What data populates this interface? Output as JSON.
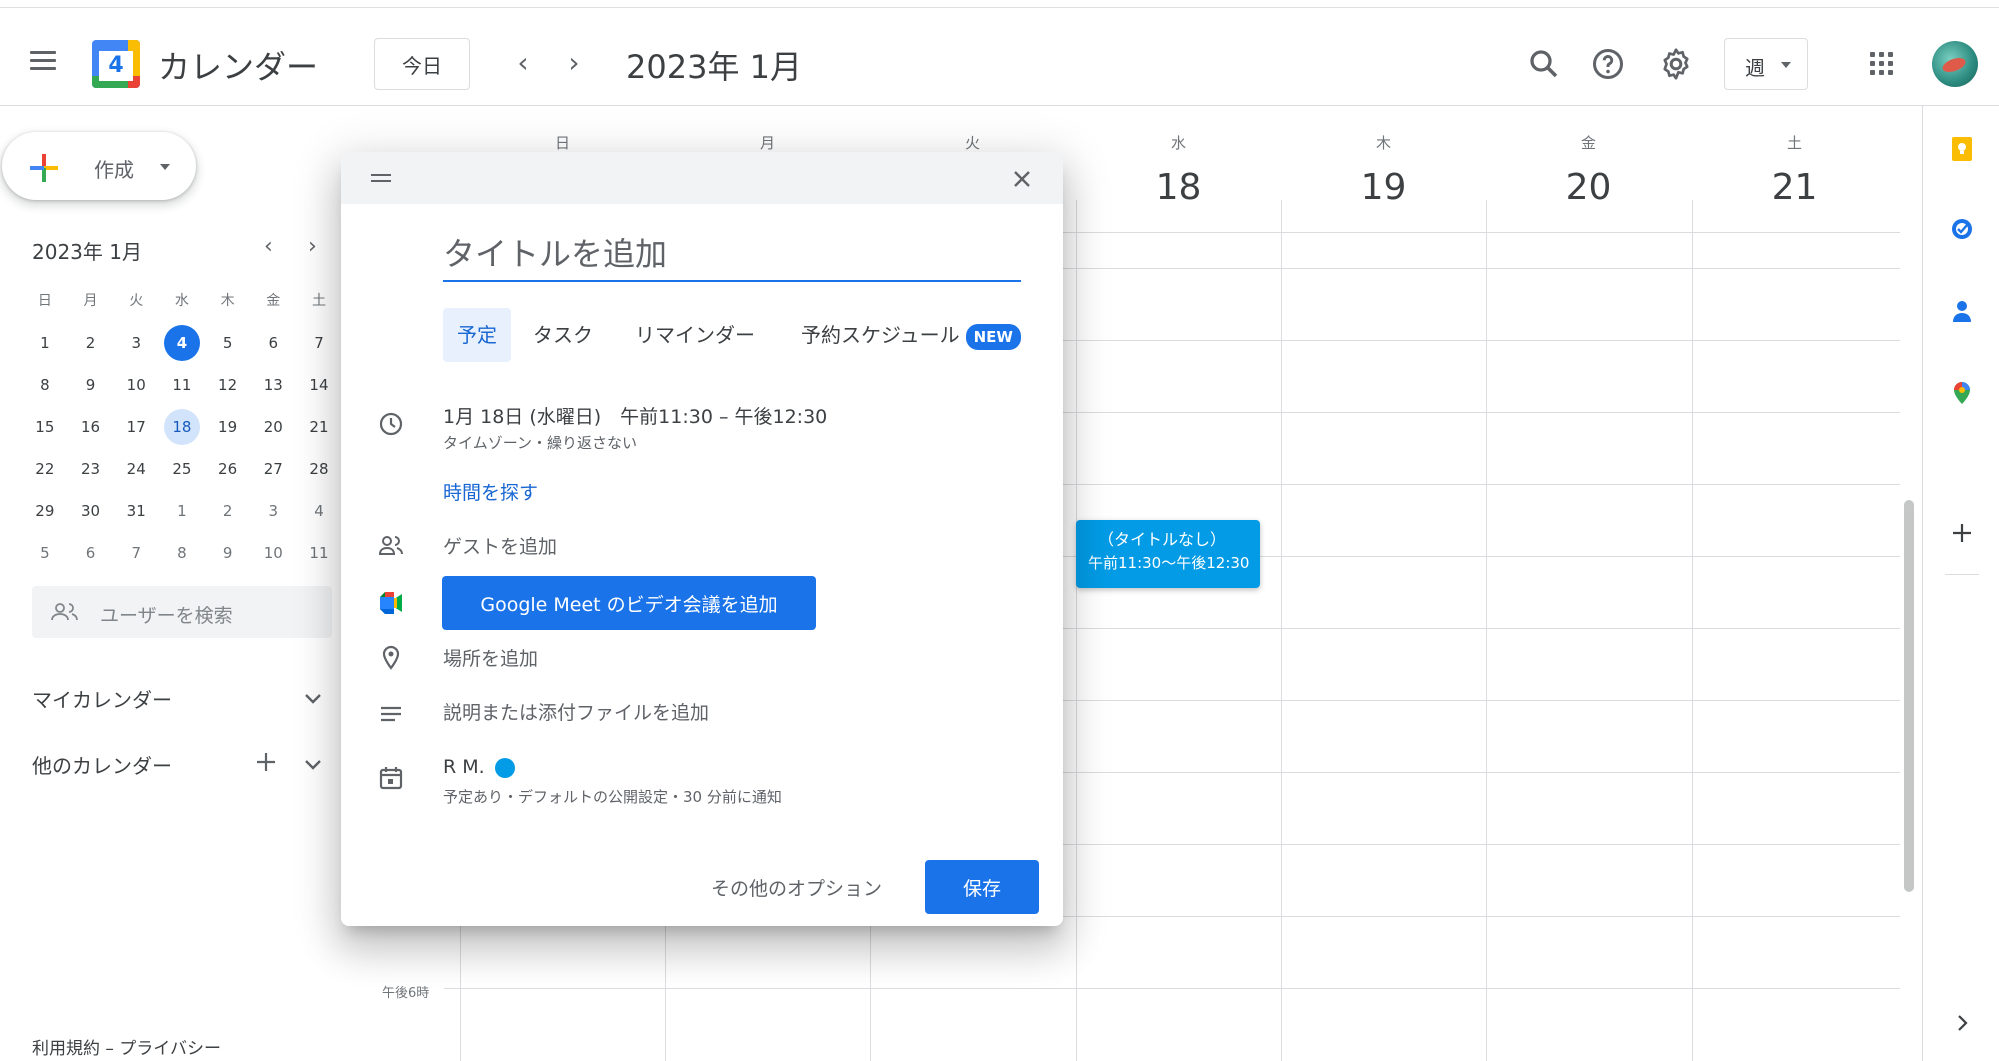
{
  "header": {
    "app_title": "カレンダー",
    "logo_day": "4",
    "today_label": "今日",
    "prev_icon": "‹",
    "next_icon": "›",
    "date_title": "2023年 1月",
    "view_label": "週",
    "icons": [
      "menu-icon",
      "search-icon",
      "help-icon",
      "settings-icon",
      "apps-icon",
      "avatar"
    ]
  },
  "sidebar": {
    "create_label": "作成",
    "mini_calendar": {
      "title": "2023年 1月",
      "weekdays": [
        "日",
        "月",
        "火",
        "水",
        "木",
        "金",
        "土"
      ],
      "weeks": [
        [
          "1",
          "2",
          "3",
          "4",
          "5",
          "6",
          "7"
        ],
        [
          "8",
          "9",
          "10",
          "11",
          "12",
          "13",
          "14"
        ],
        [
          "15",
          "16",
          "17",
          "18",
          "19",
          "20",
          "21"
        ],
        [
          "22",
          "23",
          "24",
          "25",
          "26",
          "27",
          "28"
        ],
        [
          "29",
          "30",
          "31",
          "1",
          "2",
          "3",
          "4"
        ],
        [
          "5",
          "6",
          "7",
          "8",
          "9",
          "10",
          "11"
        ]
      ],
      "today": "4",
      "selected": "18"
    },
    "search_users_placeholder": "ユーザーを検索",
    "my_calendars": "マイカレンダー",
    "other_calendars": "他のカレンダー",
    "footer": "利用規約 – プライバシー"
  },
  "week": {
    "days": [
      {
        "dow": "日",
        "num": ""
      },
      {
        "dow": "月",
        "num": ""
      },
      {
        "dow": "火",
        "num": ""
      },
      {
        "dow": "水",
        "num": "18"
      },
      {
        "dow": "木",
        "num": "19"
      },
      {
        "dow": "金",
        "num": "20"
      },
      {
        "dow": "土",
        "num": "21"
      }
    ],
    "hour_label": "午後6時"
  },
  "event": {
    "title": "（タイトルなし）",
    "time": "午前11:30～午後12:30",
    "color": "#039be5"
  },
  "dialog": {
    "title_placeholder": "タイトルを追加",
    "tabs": {
      "event": "予定",
      "task": "タスク",
      "reminder": "リマインダー",
      "schedule": "予約スケジュール",
      "new_badge": "NEW"
    },
    "datetime": "1月 18日 (水曜日)　午前11:30 – 午後12:30",
    "datetime_sub": "タイムゾーン・繰り返さない",
    "find_time": "時間を探す",
    "add_guests": "ゲストを追加",
    "meet_button": "Google Meet のビデオ会議を追加",
    "add_location": "場所を追加",
    "add_description": "説明または添付ファイルを追加",
    "calendar_owner": "R M.",
    "calendar_sub": "予定あり・デフォルトの公開設定・30 分前に通知",
    "more_options": "その他のオプション",
    "save": "保存"
  },
  "colors": {
    "accent": "#1a73e8",
    "event": "#039be5"
  }
}
